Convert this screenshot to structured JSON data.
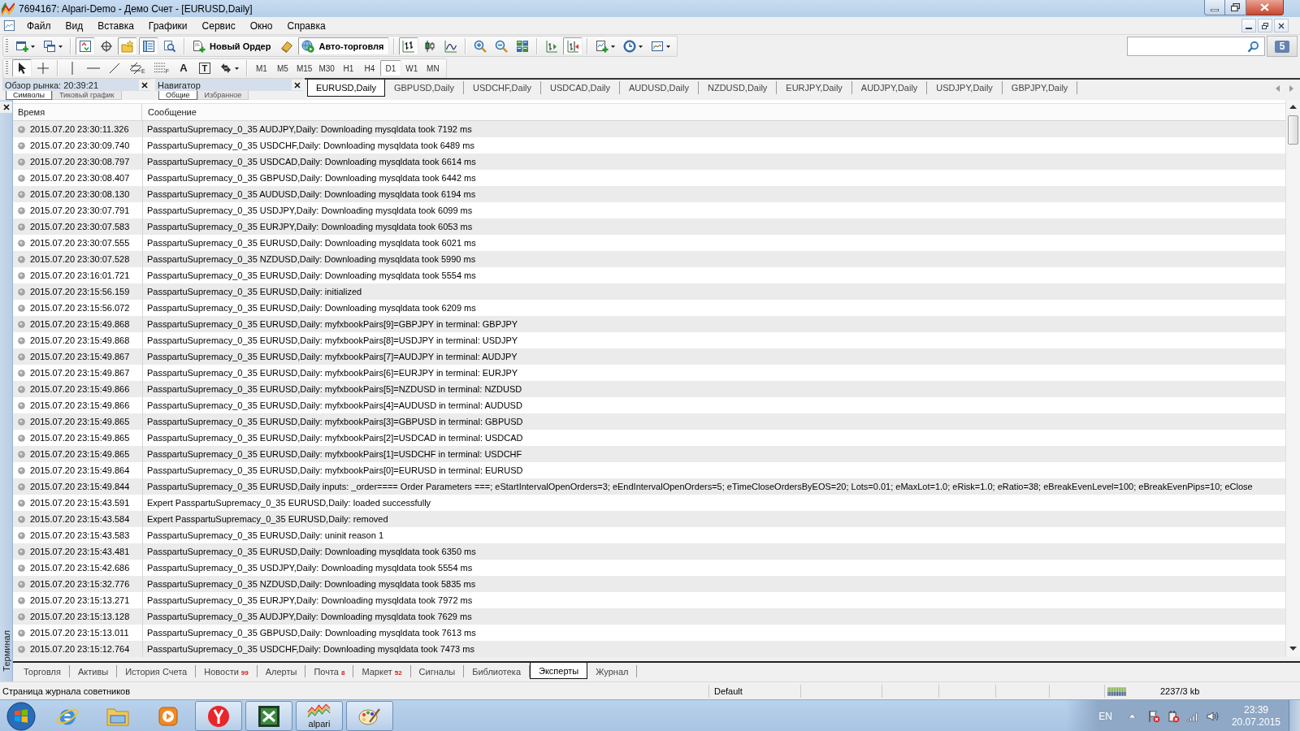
{
  "window": {
    "title": "7694167: Alpari-Demo - Демо Счет - [EURUSD,Daily]"
  },
  "menu": [
    "Файл",
    "Вид",
    "Вставка",
    "Графики",
    "Сервис",
    "Окно",
    "Справка"
  ],
  "toolbar": [
    {
      "pressed": false
    },
    {
      "pressed": false
    },
    {
      "pressed": true
    },
    {
      "pressed": false
    },
    {
      "pressed": true
    },
    {
      "pressed": true
    },
    {
      "pressed": false
    },
    {
      "label": "Новый Ордер",
      "pressed": false
    },
    {
      "pressed": false
    },
    {
      "label": "Авто-торговля",
      "pressed": true
    },
    {
      "pressed": true
    },
    {
      "pressed": false
    },
    {
      "pressed": false
    },
    {
      "pressed": false
    },
    {
      "pressed": false
    },
    {
      "pressed": false
    },
    {
      "pressed": false
    },
    {
      "pressed": true
    },
    {
      "pressed": false
    },
    {
      "pressed": false
    },
    {
      "pressed": false
    }
  ],
  "search": {
    "message_count": "5"
  },
  "drawing_tools": [
    {
      "pressed": true
    },
    {
      "pressed": false
    },
    {
      "pressed": false
    },
    {
      "pressed": false
    },
    {
      "pressed": false
    },
    {
      "pressed": false,
      "mark": "E"
    },
    {
      "pressed": false,
      "mark": "F"
    },
    {
      "pressed": false,
      "label": "A"
    },
    {
      "pressed": false,
      "label": "T"
    },
    {
      "pressed": false
    }
  ],
  "periods": [
    {
      "label": "M1",
      "selected": false
    },
    {
      "label": "M5",
      "selected": false
    },
    {
      "label": "M15",
      "selected": false
    },
    {
      "label": "M30",
      "selected": false
    },
    {
      "label": "H1",
      "selected": false
    },
    {
      "label": "H4",
      "selected": false
    },
    {
      "label": "D1",
      "selected": true
    },
    {
      "label": "W1",
      "selected": false
    },
    {
      "label": "MN",
      "selected": false
    }
  ],
  "panels": [
    {
      "title": "Обзор рынка: 20:39:21",
      "tabs": [
        {
          "label": "Символы",
          "selected": true
        },
        {
          "label": "Тиковый график",
          "selected": false
        }
      ]
    },
    {
      "title": "Навигатор",
      "tabs": [
        {
          "label": "Общие",
          "selected": true
        },
        {
          "label": "Избранное",
          "selected": false
        }
      ]
    }
  ],
  "chart_tabs": [
    {
      "label": "EURUSD,Daily",
      "selected": true
    },
    {
      "label": "GBPUSD,Daily",
      "selected": false
    },
    {
      "label": "USDCHF,Daily",
      "selected": false
    },
    {
      "label": "USDCAD,Daily",
      "selected": false
    },
    {
      "label": "AUDUSD,Daily",
      "selected": false
    },
    {
      "label": "NZDUSD,Daily",
      "selected": false
    },
    {
      "label": "EURJPY,Daily",
      "selected": false
    },
    {
      "label": "AUDJPY,Daily",
      "selected": false
    },
    {
      "label": "USDJPY,Daily",
      "selected": false
    },
    {
      "label": "GBPJPY,Daily",
      "selected": false
    }
  ],
  "terminal": {
    "label": "Терминал",
    "columns": [
      "Время",
      "Сообщение"
    ],
    "rows": [
      {
        "time": "2015.07.20 23:30:11.326",
        "message": "PasspartuSupremacy_0_35 AUDJPY,Daily: Downloading mysqldata took 7192 ms"
      },
      {
        "time": "2015.07.20 23:30:09.740",
        "message": "PasspartuSupremacy_0_35 USDCHF,Daily: Downloading mysqldata took 6489 ms"
      },
      {
        "time": "2015.07.20 23:30:08.797",
        "message": "PasspartuSupremacy_0_35 USDCAD,Daily: Downloading mysqldata took 6614 ms"
      },
      {
        "time": "2015.07.20 23:30:08.407",
        "message": "PasspartuSupremacy_0_35 GBPUSD,Daily: Downloading mysqldata took 6442 ms"
      },
      {
        "time": "2015.07.20 23:30:08.130",
        "message": "PasspartuSupremacy_0_35 AUDUSD,Daily: Downloading mysqldata took 6194 ms"
      },
      {
        "time": "2015.07.20 23:30:07.791",
        "message": "PasspartuSupremacy_0_35 USDJPY,Daily: Downloading mysqldata took 6099 ms"
      },
      {
        "time": "2015.07.20 23:30:07.583",
        "message": "PasspartuSupremacy_0_35 EURJPY,Daily: Downloading mysqldata took 6053 ms"
      },
      {
        "time": "2015.07.20 23:30:07.555",
        "message": "PasspartuSupremacy_0_35 EURUSD,Daily: Downloading mysqldata took 6021 ms"
      },
      {
        "time": "2015.07.20 23:30:07.528",
        "message": "PasspartuSupremacy_0_35 NZDUSD,Daily: Downloading mysqldata took 5990 ms"
      },
      {
        "time": "2015.07.20 23:16:01.721",
        "message": "PasspartuSupremacy_0_35 EURUSD,Daily: Downloading mysqldata took 5554 ms"
      },
      {
        "time": "2015.07.20 23:15:56.159",
        "message": "PasspartuSupremacy_0_35 EURUSD,Daily: initialized"
      },
      {
        "time": "2015.07.20 23:15:56.072",
        "message": "PasspartuSupremacy_0_35 EURUSD,Daily: Downloading mysqldata took 6209 ms"
      },
      {
        "time": "2015.07.20 23:15:49.868",
        "message": "PasspartuSupremacy_0_35 EURUSD,Daily: myfxbookPairs[9]=GBPJPY in terminal: GBPJPY"
      },
      {
        "time": "2015.07.20 23:15:49.868",
        "message": "PasspartuSupremacy_0_35 EURUSD,Daily: myfxbookPairs[8]=USDJPY in terminal: USDJPY"
      },
      {
        "time": "2015.07.20 23:15:49.867",
        "message": "PasspartuSupremacy_0_35 EURUSD,Daily: myfxbookPairs[7]=AUDJPY in terminal: AUDJPY"
      },
      {
        "time": "2015.07.20 23:15:49.867",
        "message": "PasspartuSupremacy_0_35 EURUSD,Daily: myfxbookPairs[6]=EURJPY in terminal: EURJPY"
      },
      {
        "time": "2015.07.20 23:15:49.866",
        "message": "PasspartuSupremacy_0_35 EURUSD,Daily: myfxbookPairs[5]=NZDUSD in terminal: NZDUSD"
      },
      {
        "time": "2015.07.20 23:15:49.866",
        "message": "PasspartuSupremacy_0_35 EURUSD,Daily: myfxbookPairs[4]=AUDUSD in terminal: AUDUSD"
      },
      {
        "time": "2015.07.20 23:15:49.865",
        "message": "PasspartuSupremacy_0_35 EURUSD,Daily: myfxbookPairs[3]=GBPUSD in terminal: GBPUSD"
      },
      {
        "time": "2015.07.20 23:15:49.865",
        "message": "PasspartuSupremacy_0_35 EURUSD,Daily: myfxbookPairs[2]=USDCAD in terminal: USDCAD"
      },
      {
        "time": "2015.07.20 23:15:49.865",
        "message": "PasspartuSupremacy_0_35 EURUSD,Daily: myfxbookPairs[1]=USDCHF in terminal: USDCHF"
      },
      {
        "time": "2015.07.20 23:15:49.864",
        "message": "PasspartuSupremacy_0_35 EURUSD,Daily: myfxbookPairs[0]=EURUSD in terminal: EURUSD"
      },
      {
        "time": "2015.07.20 23:15:49.844",
        "message": "PasspartuSupremacy_0_35 EURUSD,Daily inputs: _order==== Order Parameters ===; eStartIntervalOpenOrders=3; eEndIntervalOpenOrders=5; eTimeCloseOrdersByEOS=20; Lots=0.01; eMaxLot=1.0; eRisk=1.0; eRatio=38; eBreakEvenLevel=100; eBreakEvenPips=10; eClose"
      },
      {
        "time": "2015.07.20 23:15:43.591",
        "message": "Expert PasspartuSupremacy_0_35 EURUSD,Daily: loaded successfully"
      },
      {
        "time": "2015.07.20 23:15:43.584",
        "message": "Expert PasspartuSupremacy_0_35 EURUSD,Daily: removed"
      },
      {
        "time": "2015.07.20 23:15:43.583",
        "message": "PasspartuSupremacy_0_35 EURUSD,Daily: uninit reason 1"
      },
      {
        "time": "2015.07.20 23:15:43.481",
        "message": "PasspartuSupremacy_0_35 EURUSD,Daily: Downloading mysqldata took 6350 ms"
      },
      {
        "time": "2015.07.20 23:15:42.686",
        "message": "PasspartuSupremacy_0_35 USDJPY,Daily: Downloading mysqldata took 5554 ms"
      },
      {
        "time": "2015.07.20 23:15:32.776",
        "message": "PasspartuSupremacy_0_35 NZDUSD,Daily: Downloading mysqldata took 5835 ms"
      },
      {
        "time": "2015.07.20 23:15:13.271",
        "message": "PasspartuSupremacy_0_35 EURJPY,Daily: Downloading mysqldata took 7972 ms"
      },
      {
        "time": "2015.07.20 23:15:13.128",
        "message": "PasspartuSupremacy_0_35 AUDJPY,Daily: Downloading mysqldata took 7629 ms"
      },
      {
        "time": "2015.07.20 23:15:13.011",
        "message": "PasspartuSupremacy_0_35 GBPUSD,Daily: Downloading mysqldata took 7613 ms"
      },
      {
        "time": "2015.07.20 23:15:12.764",
        "message": "PasspartuSupremacy_0_35 USDCHF,Daily: Downloading mysqldata took 7473 ms"
      }
    ],
    "tabs": [
      {
        "label": "Торговля",
        "selected": false
      },
      {
        "label": "Активы",
        "selected": false
      },
      {
        "label": "История Счета",
        "selected": false
      },
      {
        "label": "Новости",
        "count": "99",
        "selected": false
      },
      {
        "label": "Алерты",
        "selected": false
      },
      {
        "label": "Почта",
        "count": "8",
        "selected": false
      },
      {
        "label": "Маркет",
        "count": "52",
        "selected": false
      },
      {
        "label": "Сигналы",
        "selected": false
      },
      {
        "label": "Библиотека",
        "selected": false
      },
      {
        "label": "Эксперты",
        "selected": true
      },
      {
        "label": "Журнал",
        "selected": false
      }
    ]
  },
  "status_bar": {
    "message": "Страница журнала советников",
    "profile": "Default",
    "traffic": "2237/3 kb"
  },
  "taskbar": {
    "apps": [
      {
        "running": false
      },
      {
        "running": false
      },
      {
        "running": false
      },
      {
        "running": true
      },
      {
        "running": true
      },
      {
        "running": true,
        "label": "alpari"
      },
      {
        "running": true
      }
    ],
    "tray": {
      "language": "EN",
      "time": "23:39",
      "date": "20.07.2015"
    }
  }
}
